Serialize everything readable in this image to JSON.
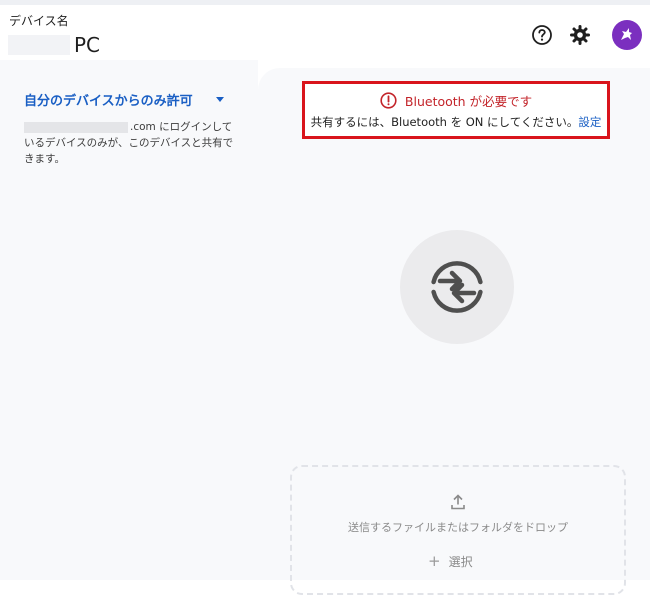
{
  "header": {
    "device_caption": "デバイス名",
    "device_name": "PC",
    "help_icon": "help-circle-icon",
    "settings_icon": "gear-icon",
    "avatar_icon": "unicorn-avatar-icon"
  },
  "sidebar": {
    "visibility_label": "自分のデバイスからのみ許可",
    "visibility_desc_domain": ".com",
    "visibility_desc_rest": " にログインしているデバイスのみが、このデバイスと共有できます。"
  },
  "alert": {
    "title": "Bluetooth が必要です",
    "message": "共有するには、Bluetooth を ON にしてください。",
    "settings_link": "設定",
    "color": "#d9141c"
  },
  "share": {
    "icon": "sync-arrows-icon"
  },
  "dropzone": {
    "text": "送信するファイルまたはフォルダをドロップ",
    "select_label": "選択",
    "upload_icon": "upload-icon",
    "plus_icon": "plus-icon"
  },
  "colors": {
    "accent": "#1a5fc4",
    "alert": "#c3242a",
    "avatar": "#7b2fbf"
  }
}
